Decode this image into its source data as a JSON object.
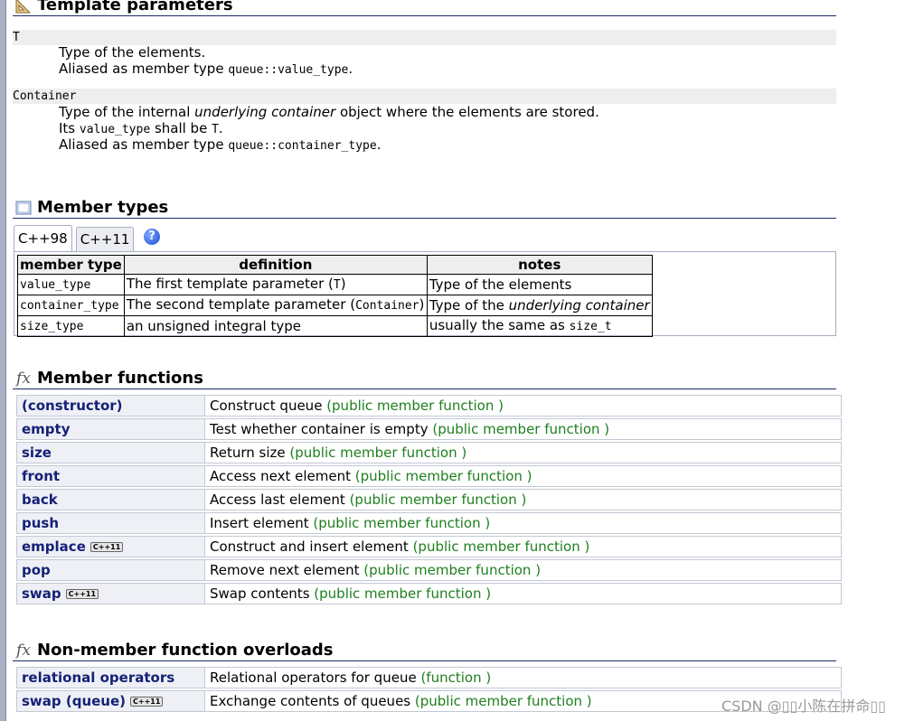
{
  "template_params": {
    "title": "Template parameters",
    "params": [
      {
        "name": "T",
        "lines": [
          "Type of the elements.",
          "Aliased as member type ",
          "queue::value_type",
          "."
        ]
      },
      {
        "name": "Container"
      }
    ],
    "t_desc_1": "Type of the elements.",
    "t_desc_2_pre": "Aliased as member type ",
    "t_desc_2_code": "queue::value_type",
    "t_desc_2_post": ".",
    "c_desc_1_pre": "Type of the internal ",
    "c_desc_1_em": "underlying container",
    "c_desc_1_post": " object where the elements are stored.",
    "c_desc_2_pre": "Its ",
    "c_desc_2_code": "value_type",
    "c_desc_2_mid": " shall be ",
    "c_desc_2_code2": "T",
    "c_desc_2_post": ".",
    "c_desc_3_pre": "Aliased as member type ",
    "c_desc_3_code": "queue::container_type",
    "c_desc_3_post": "."
  },
  "member_types": {
    "title": "Member types",
    "tabs": [
      "C++98",
      "C++11"
    ],
    "help": "?",
    "headers": [
      "member type",
      "definition",
      "notes"
    ],
    "rows": [
      {
        "type": "value_type",
        "def_pre": "The first template parameter (",
        "def_code": "T",
        "def_post": ")",
        "notes_pre": "Type of the elements",
        "notes_em": "",
        "notes_code": ""
      },
      {
        "type": "container_type",
        "def_pre": "The second template parameter (",
        "def_code": "Container",
        "def_post": ")",
        "notes_pre": "Type of the ",
        "notes_em": "underlying container",
        "notes_code": ""
      },
      {
        "type": "size_type",
        "def_pre": "an unsigned integral type",
        "def_code": "",
        "def_post": "",
        "notes_pre": "usually the same as ",
        "notes_em": "",
        "notes_code": "size_t"
      }
    ]
  },
  "member_functions": {
    "title": "Member functions",
    "icon": "fx",
    "badge": "C++11",
    "items": [
      {
        "name": "(constructor)",
        "desc": "Construct queue ",
        "kind": "(public member function )"
      },
      {
        "name": "empty",
        "desc": "Test whether container is empty ",
        "kind": "(public member function )"
      },
      {
        "name": "size",
        "desc": "Return size ",
        "kind": "(public member function )"
      },
      {
        "name": "front",
        "desc": "Access next element ",
        "kind": "(public member function )"
      },
      {
        "name": "back",
        "desc": "Access last element ",
        "kind": "(public member function )"
      },
      {
        "name": "push",
        "desc": "Insert element ",
        "kind": "(public member function )"
      },
      {
        "name": "emplace",
        "desc": "Construct and insert element ",
        "kind": "(public member function )"
      },
      {
        "name": "pop",
        "desc": "Remove next element ",
        "kind": "(public member function )"
      },
      {
        "name": "swap",
        "desc": "Swap contents ",
        "kind": "(public member function )"
      }
    ]
  },
  "non_member": {
    "title": "Non-member function overloads",
    "icon": "fx",
    "items": [
      {
        "name": "relational operators",
        "desc": "Relational operators for queue ",
        "kind": "(function )"
      },
      {
        "name": "swap (queue)",
        "desc": "Exchange contents of queues ",
        "kind": "(public member function )"
      }
    ]
  },
  "watermark": "CSDN @▯▯小陈在拼命▯▯"
}
